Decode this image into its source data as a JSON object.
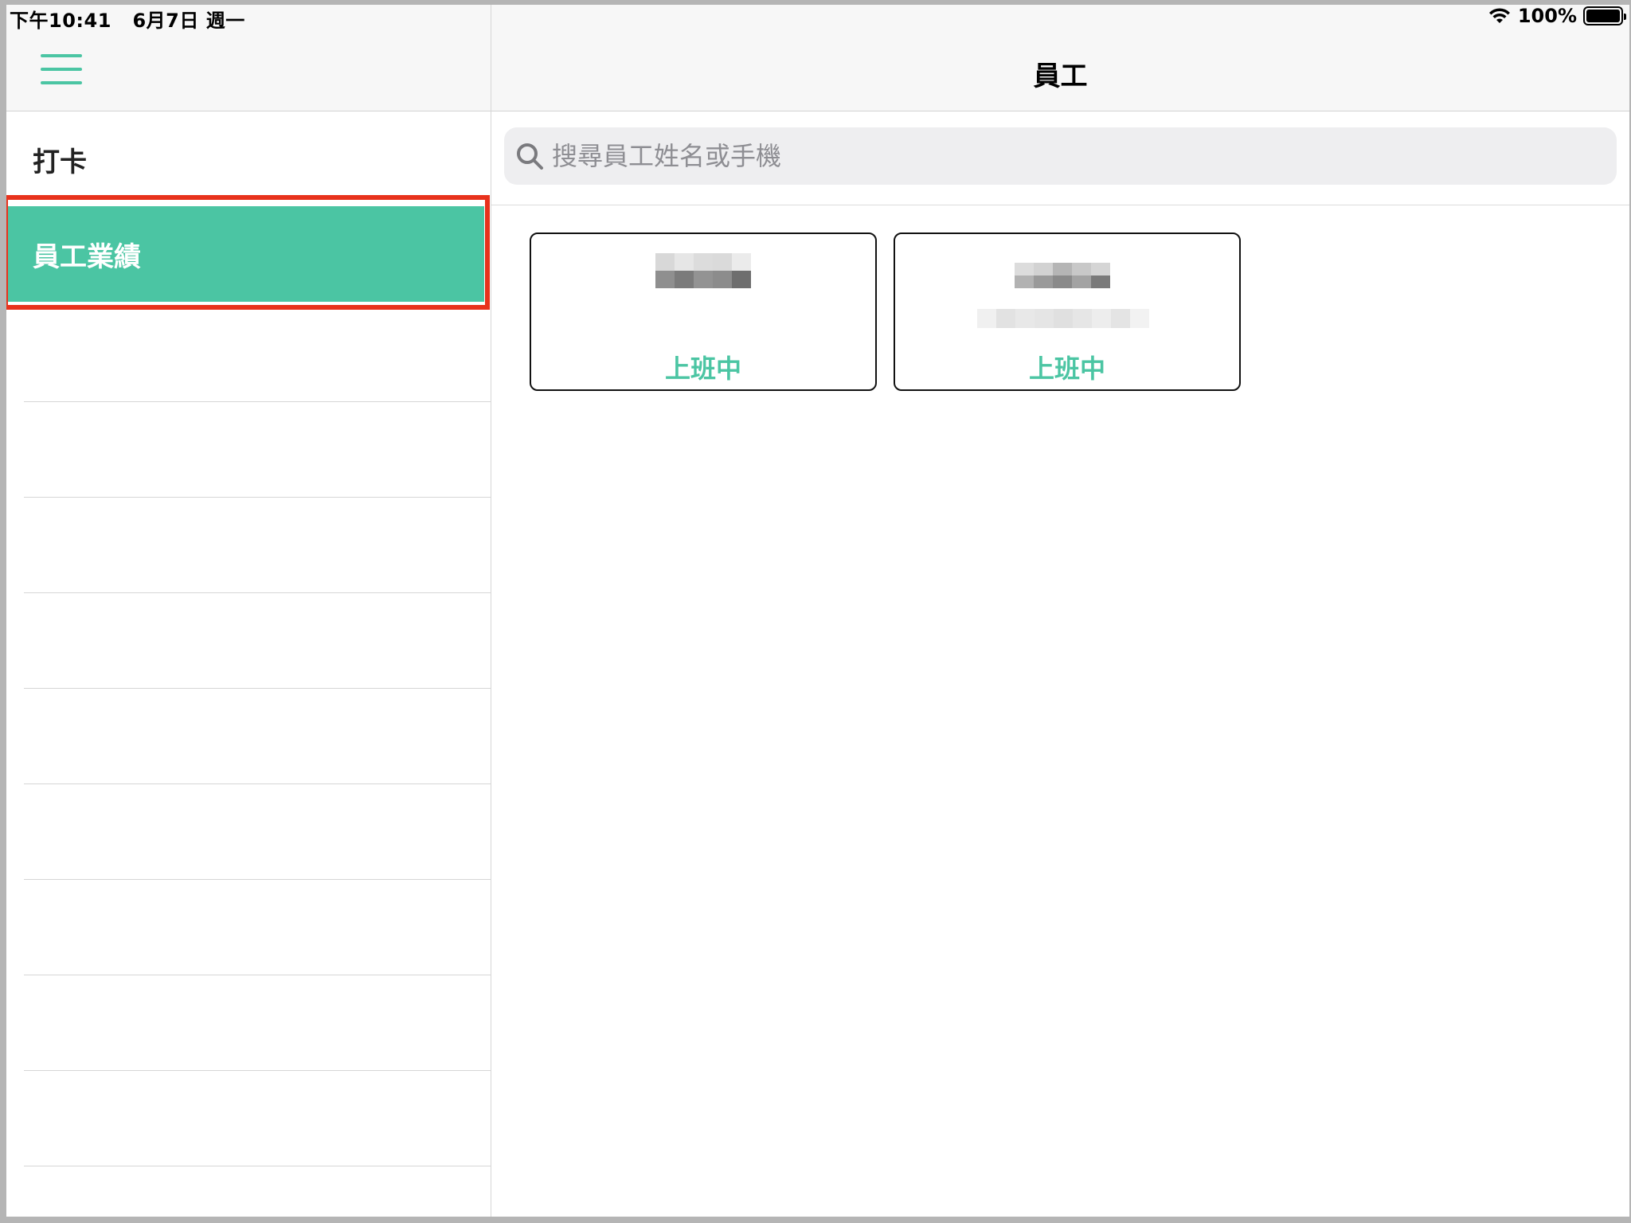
{
  "status_bar": {
    "time": "下午10:41",
    "date": "6月7日 週一",
    "battery_percent": "100%",
    "battery_level": 1.0
  },
  "sidebar": {
    "items": [
      {
        "label": "打卡",
        "selected": false
      },
      {
        "label": "員工業績",
        "selected": true
      }
    ],
    "accent_color": "#4bc5a3",
    "highlight_color": "#e8321c",
    "menu_icon": "hamburger-menu-icon"
  },
  "main": {
    "title": "員工",
    "search": {
      "placeholder": "搜尋員工姓名或手機",
      "value": "",
      "icon": "search-icon"
    },
    "employees": [
      {
        "status": "上班中"
      },
      {
        "status": "上班中"
      }
    ]
  }
}
